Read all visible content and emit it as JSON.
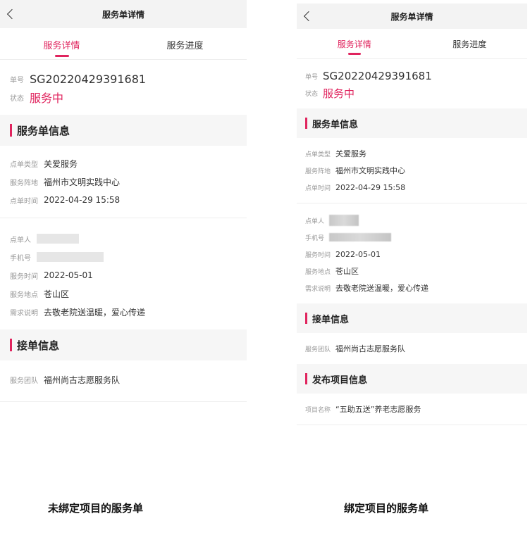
{
  "left": {
    "nav_title": "服务单详情",
    "tabs": [
      "服务详情",
      "服务进度"
    ],
    "order_no_label": "单号",
    "order_no": "SG20220429391681",
    "status_label": "状态",
    "status": "服务中",
    "sections": {
      "order_info": "服务单信息",
      "accept_info": "接单信息"
    },
    "order_fields": [
      {
        "label": "点单类型",
        "value": "关爱服务"
      },
      {
        "label": "服务阵地",
        "value": "福州市文明实践中心"
      },
      {
        "label": "点单时间",
        "value": "2022-04-29 15:58"
      }
    ],
    "contact_fields": [
      {
        "label": "点单人",
        "value": ""
      },
      {
        "label": "手机号",
        "value": ""
      },
      {
        "label": "服务时间",
        "value": "2022-05-01"
      },
      {
        "label": "服务地点",
        "value": "苍山区"
      },
      {
        "label": "需求说明",
        "value": "去敬老院送温暖，爱心传递"
      }
    ],
    "accept_fields": [
      {
        "label": "服务团队",
        "value": "福州尚古志愿服务队"
      }
    ],
    "caption": "未绑定项目的服务单"
  },
  "right": {
    "nav_title": "服务单详情",
    "tabs": [
      "服务详情",
      "服务进度"
    ],
    "order_no_label": "单号",
    "order_no": "SG20220429391681",
    "status_label": "状态",
    "status": "服务中",
    "sections": {
      "order_info": "服务单信息",
      "accept_info": "接单信息",
      "project_info": "发布项目信息"
    },
    "order_fields": [
      {
        "label": "点单类型",
        "value": "关爱服务"
      },
      {
        "label": "服务阵地",
        "value": "福州市文明实践中心"
      },
      {
        "label": "点单时间",
        "value": "2022-04-29 15:58"
      }
    ],
    "contact_fields": [
      {
        "label": "点单人",
        "value": ""
      },
      {
        "label": "手机号",
        "value": ""
      },
      {
        "label": "服务时间",
        "value": "2022-05-01"
      },
      {
        "label": "服务地点",
        "value": "苍山区"
      },
      {
        "label": "需求说明",
        "value": "去敬老院送温暖，爱心传递"
      }
    ],
    "accept_fields": [
      {
        "label": "服务团队",
        "value": "福州尚古志愿服务队"
      }
    ],
    "project_fields": [
      {
        "label": "项目名称",
        "value": "“五助五送”养老志愿服务"
      }
    ],
    "caption": "绑定项目的服务单"
  },
  "colors": {
    "accent": "#e0245e",
    "section_bg": "#f6f6f6",
    "nav_bg": "#f3f3f3"
  },
  "icons": {
    "back": "chevron-left-icon"
  }
}
